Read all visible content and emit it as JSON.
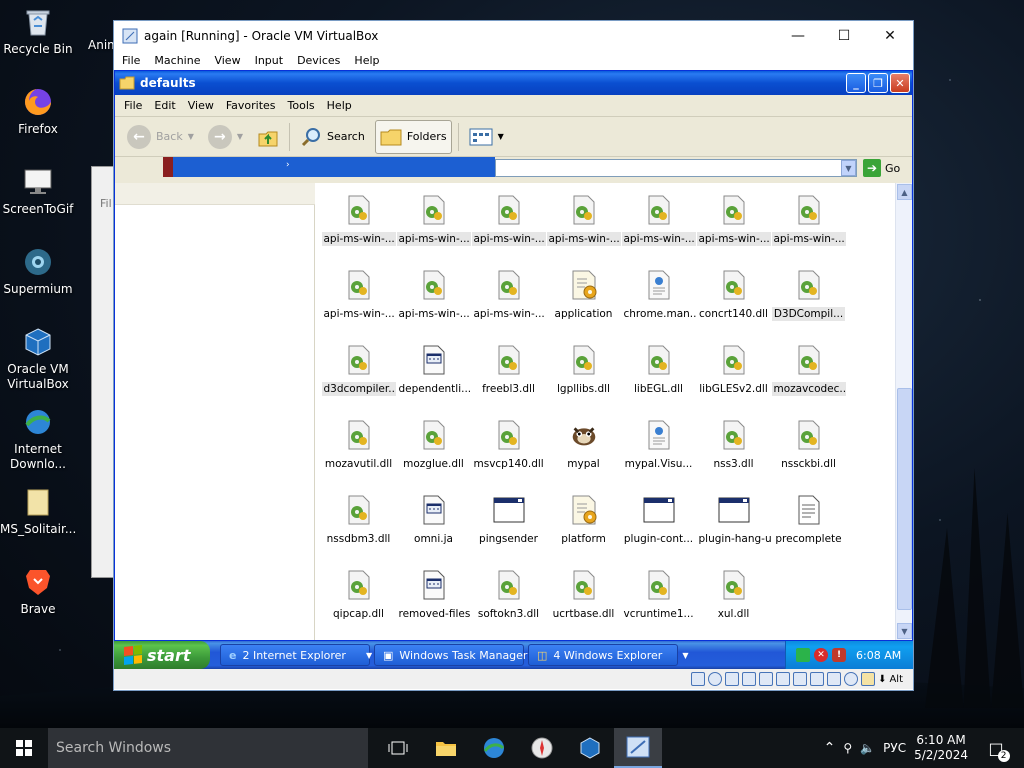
{
  "desktop": {
    "icons": [
      {
        "label": "Recycle Bin",
        "icon": "recycle-bin-icon"
      },
      {
        "label": "Firefox",
        "icon": "firefox-icon"
      },
      {
        "label": "ScreenToGif",
        "icon": "screentogif-icon"
      },
      {
        "label": "Supermium",
        "icon": "supermium-icon"
      },
      {
        "label": "Oracle VM VirtualBox",
        "icon": "virtualbox-icon"
      },
      {
        "label": "Internet Downlo...",
        "icon": "internet-download-manager-icon"
      },
      {
        "label": "MS_Solitair...",
        "icon": "folder-icon"
      },
      {
        "label": "Brave",
        "icon": "brave-icon"
      }
    ],
    "partial_label": "Anim"
  },
  "vbox": {
    "title": "again [Running] - Oracle VM VirtualBox",
    "menu": [
      "File",
      "Machine",
      "View",
      "Input",
      "Devices",
      "Help"
    ],
    "behind_menu_partial": "Fil"
  },
  "explorer": {
    "title": "defaults",
    "menu": [
      "File",
      "Edit",
      "View",
      "Favorites",
      "Tools",
      "Help"
    ],
    "toolbar": {
      "back": "Back",
      "search": "Search",
      "folders": "Folders"
    },
    "address": {
      "go": "Go"
    },
    "files": [
      "api-ms-win-...",
      "api-ms-win-...",
      "api-ms-win-...",
      "api-ms-win-...",
      "api-ms-win-...",
      "api-ms-win-...",
      "api-ms-win-...",
      "api-ms-win-...",
      "api-ms-win-...",
      "api-ms-win-...",
      "application",
      "chrome.man...",
      "concrt140.dll",
      "D3DCompil...",
      "d3dcompiler...",
      "dependentli...",
      "freebl3.dll",
      "lgpllibs.dll",
      "libEGL.dll",
      "libGLESv2.dll",
      "mozavcodec...",
      "mozavutil.dll",
      "mozglue.dll",
      "msvcp140.dll",
      "mypal",
      "mypal.Visu...",
      "nss3.dll",
      "nssckbi.dll",
      "nssdbm3.dll",
      "omni.ja",
      "pingsender",
      "platform",
      "plugin-cont...",
      "plugin-hang-ui",
      "precomplete",
      "qipcap.dll",
      "removed-files",
      "softokn3.dll",
      "ucrtbase.dll",
      "vcruntime1...",
      "xul.dll"
    ],
    "file_types": [
      "dll",
      "dll",
      "dll",
      "dll",
      "dll",
      "dll",
      "dll",
      "dll",
      "dll",
      "dll",
      "config",
      "manifest",
      "dll",
      "dll",
      "dll",
      "ja",
      "dll",
      "dll",
      "dll",
      "dll",
      "dll",
      "dll",
      "dll",
      "dll",
      "app",
      "manifest",
      "dll",
      "dll",
      "dll",
      "ja",
      "exe",
      "config",
      "exe",
      "exe",
      "text",
      "dll",
      "ja",
      "dll",
      "dll",
      "dll",
      "dll"
    ]
  },
  "xp_taskbar": {
    "start": "start",
    "tasks": [
      "2 Internet Explorer",
      "Windows Task Manager",
      "4 Windows Explorer"
    ],
    "clock": "6:08 AM"
  },
  "vbox_status": {
    "host_key": "Alt"
  },
  "win10_taskbar": {
    "search_placeholder": "Search Windows",
    "lang": "РУС",
    "time": "6:10 AM",
    "date": "5/2/2024",
    "notifications": "2"
  }
}
